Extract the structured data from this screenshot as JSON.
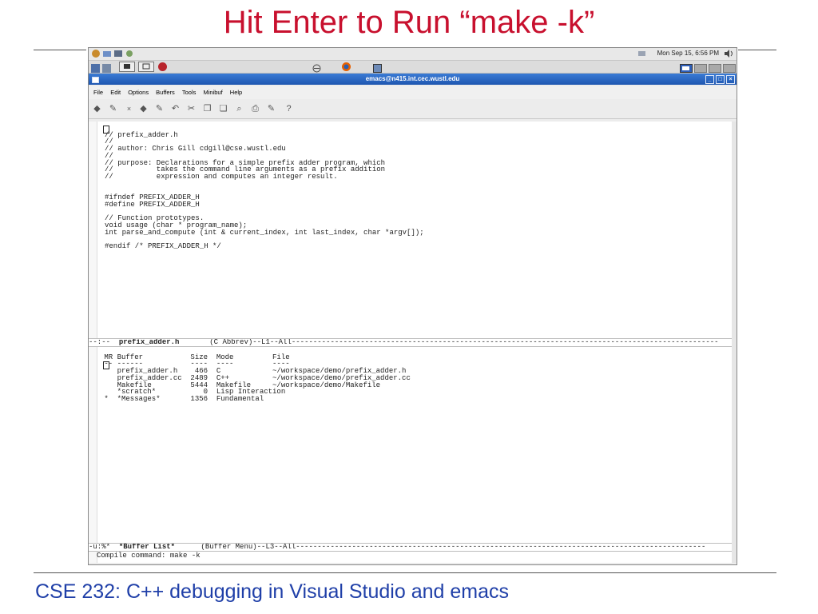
{
  "slide": {
    "title": "Hit Enter to Run “make -k”",
    "footer": "CSE 232: C++ debugging in Visual Studio and emacs"
  },
  "panel": {
    "clock": "Mon Sep 15,  6:56 PM"
  },
  "window": {
    "title": "emacs@n415.int.cec.wustl.edu",
    "menu": [
      "File",
      "Edit",
      "Options",
      "Buffers",
      "Tools",
      "Minibuf",
      "Help"
    ]
  },
  "editor": {
    "code_lines": [
      "// prefix_adder.h",
      "//",
      "// author: Chris Gill cdgill@cse.wustl.edu",
      "//",
      "// purpose: Declarations for a simple prefix adder program, which",
      "//          takes the command line arguments as a prefix addition",
      "//          expression and computes an integer result.",
      "",
      "",
      "#ifndef PREFIX_ADDER_H",
      "#define PREFIX_ADDER_H",
      "",
      "// Function prototypes.",
      "void usage (char * program_name);",
      "int parse_and_compute (int & current_index, int last_index, char *argv[]);",
      "",
      "#endif /* PREFIX_ADDER_H */"
    ],
    "modeline_top": {
      "prefix": "--:--  ",
      "buffer": "prefix_adder.h",
      "rest": "       (C Abbrev)--L1--All---------------------------------------------------------------------------------------------------"
    },
    "buffer_list": {
      "header": " MR Buffer           Size  Mode         File",
      "underline": " -- ------           ----  ----         ----",
      "rows": [
        "    prefix_adder.h    466  C            ~/workspace/demo/prefix_adder.h",
        "    prefix_adder.cc  2489  C++          ~/workspace/demo/prefix_adder.cc",
        "    Makefile         5444  Makefile     ~/workspace/demo/Makefile",
        "    *scratch*           0  Lisp Interaction",
        " *  *Messages*       1356  Fundamental"
      ]
    },
    "modeline_bottom": {
      "prefix": "-u:%*  ",
      "buffer": "*Buffer List*",
      "rest": "      (Buffer Menu)--L3--All-----------------------------------------------------------------------------------------------"
    },
    "minibuffer": "Compile command: make -k"
  }
}
